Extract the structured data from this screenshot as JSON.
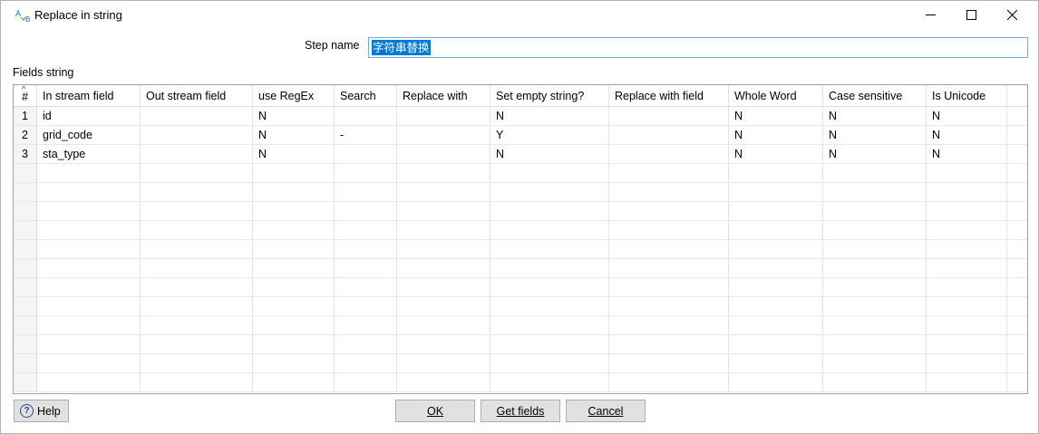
{
  "window": {
    "title": "Replace in string",
    "icon_text_a": "A",
    "icon_text_b": "B"
  },
  "step_name": {
    "label": "Step name",
    "value": "字符串替换"
  },
  "fields_label": "Fields string",
  "table": {
    "row_num_header": "#",
    "columns": [
      "In stream field",
      "Out stream field",
      "use RegEx",
      "Search",
      "Replace with",
      "Set empty string?",
      "Replace with field",
      "Whole Word",
      "Case sensitive",
      "Is Unicode"
    ],
    "rows": [
      {
        "num": "1",
        "cells": [
          "id",
          "",
          "N",
          "",
          "",
          "N",
          "",
          "N",
          "N",
          "N"
        ]
      },
      {
        "num": "2",
        "cells": [
          "grid_code",
          "",
          "N",
          "-",
          "",
          "Y",
          "",
          "N",
          "N",
          "N"
        ]
      },
      {
        "num": "3",
        "cells": [
          "sta_type",
          "",
          "N",
          "",
          "",
          "N",
          "",
          "N",
          "N",
          "N"
        ]
      }
    ]
  },
  "buttons": {
    "help": "Help",
    "ok": "OK",
    "get_fields": "Get fields",
    "cancel": "Cancel"
  }
}
